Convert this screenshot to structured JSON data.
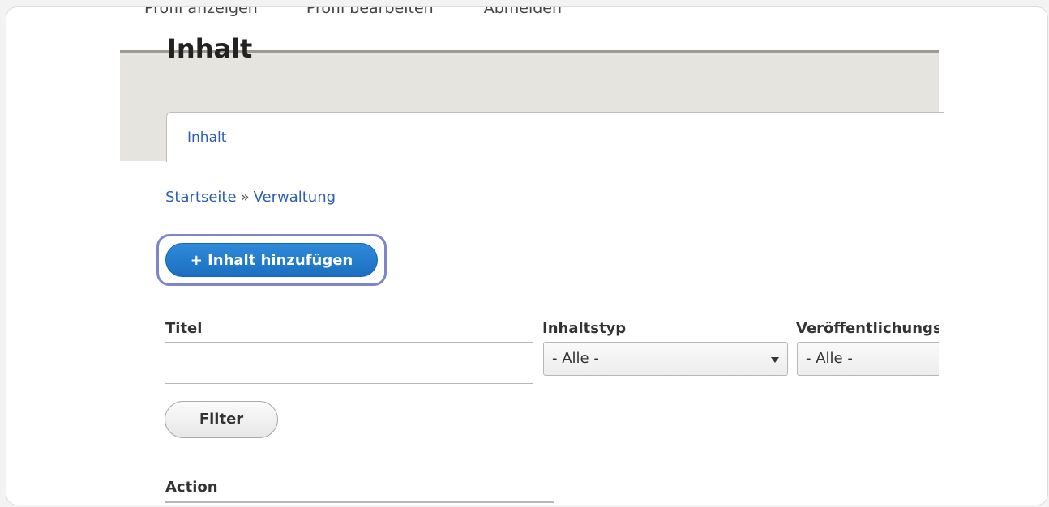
{
  "user_menu": [
    "Profil anzeigen",
    "Profil bearbeiten",
    "Abmelden"
  ],
  "page_title": "Inhalt",
  "tabs": [
    {
      "label": "Inhalt"
    }
  ],
  "breadcrumb": {
    "home": "Startseite",
    "separator": "»",
    "current": "Verwaltung"
  },
  "add_button": "+ Inhalt hinzufügen",
  "filters": {
    "title_label": "Titel",
    "title_value": "",
    "type_label": "Inhaltstyp",
    "type_value": "- Alle -",
    "publish_label": "Veröffentlichungsstatus",
    "publish_value": "- Alle -"
  },
  "filter_button": "Filter",
  "action_label": "Action",
  "colors": {
    "link": "#2d5fb0",
    "primary_button": "#1b6fc2",
    "focus_ring": "#7e85c9",
    "header_band": "#e5e4de"
  }
}
